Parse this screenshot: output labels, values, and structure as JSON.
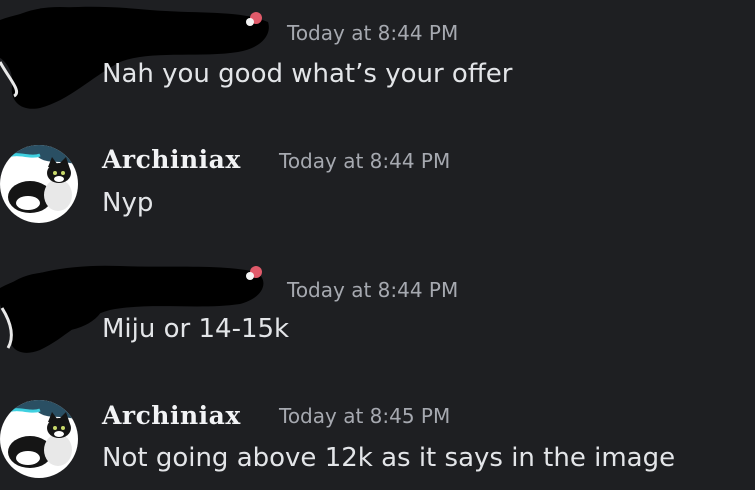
{
  "messages": [
    {
      "author": "",
      "redacted": true,
      "timestamp": "Today at 8:44 PM",
      "text": "Nah you good what’s your offer"
    },
    {
      "author": "Archiniax",
      "avatar": "cat-avatar",
      "timestamp": "Today at 8:44 PM",
      "text": "Nyp"
    },
    {
      "author": "",
      "redacted": true,
      "timestamp": "Today at 8:44 PM",
      "text": "Miju or 14-15k"
    },
    {
      "author": "Archiniax",
      "avatar": "cat-avatar",
      "timestamp": "Today at 8:45 PM",
      "text": "Not going above 12k as it says in the image"
    }
  ],
  "colors": {
    "background": "#1e1f22",
    "timestamp": "#a6a9b0",
    "message_text": "#e3e5e8",
    "username": "#f2f3f5",
    "redaction": "#000000"
  }
}
